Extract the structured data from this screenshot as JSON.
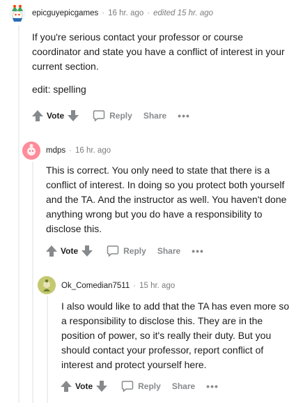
{
  "colors": {
    "line": "#edeff1",
    "muted": "#7c7c7c",
    "text": "#1c1c1c",
    "arrow": "#878a8c"
  },
  "comments": [
    {
      "author": "epicguyepicgames",
      "time": "16 hr. ago",
      "edited": "edited 15 hr. ago",
      "paragraphs": [
        "If you're serious contact your professor or course coordinator and state you have a conflict of interest in your current section.",
        "edit: spelling"
      ],
      "vote_label": "Vote",
      "reply_label": "Reply",
      "share_label": "Share",
      "more_label": "•••"
    },
    {
      "author": "mdps",
      "time": "16 hr. ago",
      "paragraphs": [
        "This is correct. You only need to state that there is a conflict of interest. In doing so you protect both yourself and the TA. And the instructor as well. You haven't done anything wrong but you do have a responsibility to disclose this."
      ],
      "vote_label": "Vote",
      "reply_label": "Reply",
      "share_label": "Share",
      "more_label": "•••"
    },
    {
      "author": "Ok_Comedian7511",
      "time": "15 hr. ago",
      "paragraphs": [
        "I also would like to add that the TA has even more so a responsibility to disclose this. They are in the position of power, so it's really their duty. But you should contact your professor, report conflict of interest and protect yourself here."
      ],
      "vote_label": "Vote",
      "reply_label": "Reply",
      "share_label": "Share",
      "more_label": "•••"
    }
  ]
}
